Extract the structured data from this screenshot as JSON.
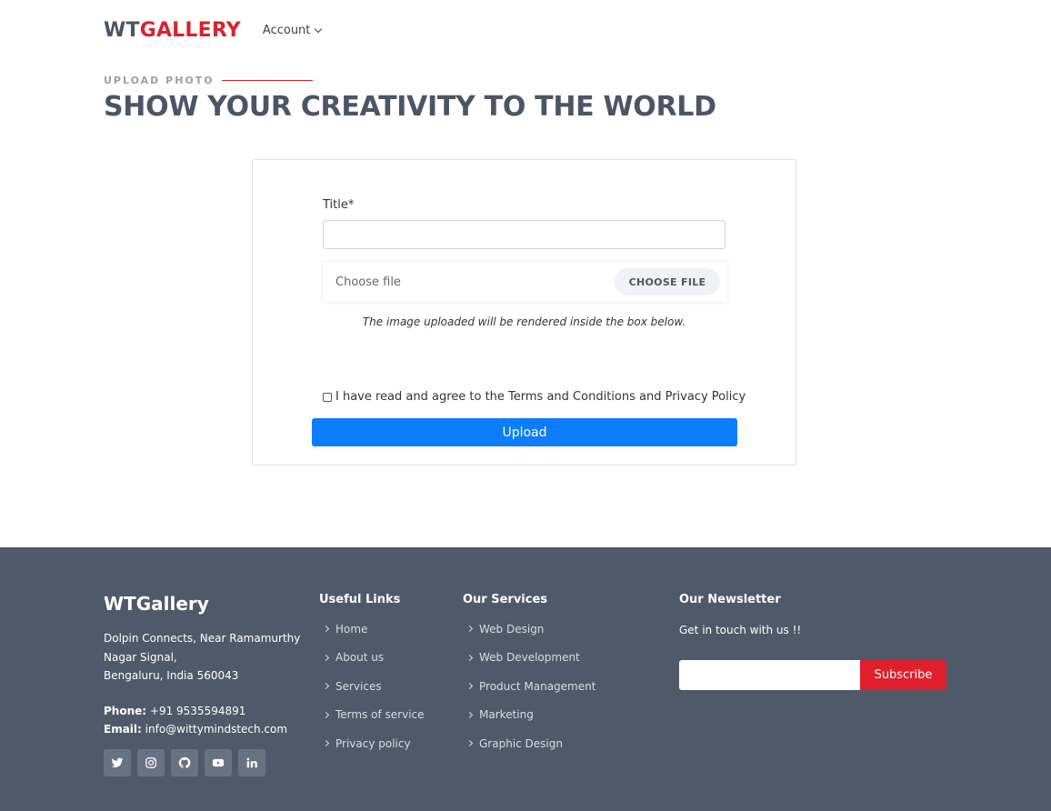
{
  "header": {
    "logo_part1": "WT",
    "logo_part2": "GALLERY",
    "account_label": "Account"
  },
  "section": {
    "eyebrow": "UPLOAD PHOTO",
    "headline": "SHOW YOUR CREATIVITY TO THE WORLD"
  },
  "form": {
    "title_label": "Title*",
    "title_value": "",
    "file_placeholder": "Choose file",
    "file_button": "CHOOSE FILE",
    "hint": "The image uploaded will be rendered inside the box below.",
    "terms_label": "I have read and agree to the Terms and Conditions and Privacy Policy",
    "terms_checked": false,
    "upload_label": "Upload"
  },
  "footer": {
    "brand": "WTGallery",
    "address_line1": "Dolpin Connects, Near Ramamurthy",
    "address_line2": "Nagar Signal,",
    "address_line3": "Bengaluru, India 560043",
    "phone_label": "Phone:",
    "phone_value": "+91 9535594891",
    "email_label": "Email:",
    "email_value": "info@wittymindstech.com",
    "socials": [
      "twitter-icon",
      "instagram-icon",
      "github-icon",
      "youtube-icon",
      "linkedin-icon"
    ],
    "useful_links_title": "Useful Links",
    "useful_links": [
      "Home",
      "About us",
      "Services",
      "Terms of service",
      "Privacy policy"
    ],
    "services_title": "Our Services",
    "services": [
      "Web Design",
      "Web Development",
      "Product Management",
      "Marketing",
      "Graphic Design"
    ],
    "newsletter_title": "Our Newsletter",
    "newsletter_text": "Get in touch with us !!",
    "subscribe_label": "Subscribe"
  },
  "colors": {
    "brand_red": "#d9232d",
    "brand_slate": "#4c5565",
    "primary_blue": "#0d7cff",
    "footer_bg": "#4e5a69",
    "subscribe_red": "#df1f2d"
  }
}
